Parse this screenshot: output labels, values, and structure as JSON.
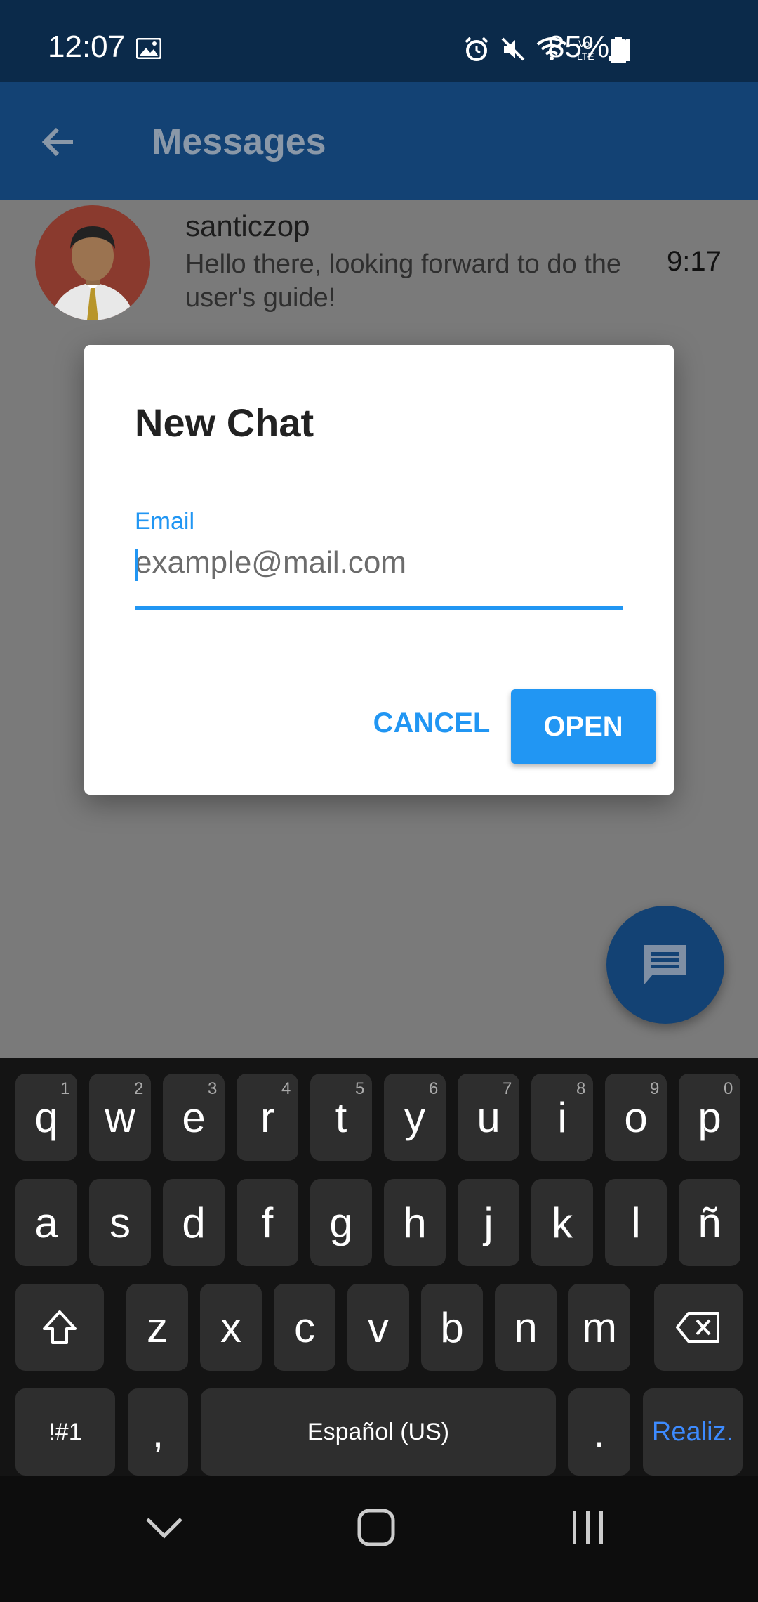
{
  "status_bar": {
    "time": "12:07",
    "battery": "85%",
    "icons": [
      "image-icon",
      "alarm-icon",
      "mute-icon",
      "wifi-icon",
      "volte-icon",
      "signal-icon",
      "battery-icon"
    ]
  },
  "app_bar": {
    "title": "Messages",
    "back_icon": "arrow-back-icon"
  },
  "chat_list": [
    {
      "name": "santiczop",
      "preview": "Hello there, looking forward to do the user's guide!",
      "time": "9:17"
    }
  ],
  "dialog": {
    "title": "New Chat",
    "field_label": "Email",
    "field_placeholder": "example@mail.com",
    "field_value": "",
    "cancel_label": "CANCEL",
    "open_label": "OPEN"
  },
  "fab": {
    "icon": "message-icon"
  },
  "keyboard": {
    "row1": [
      {
        "k": "q",
        "s": "1"
      },
      {
        "k": "w",
        "s": "2"
      },
      {
        "k": "e",
        "s": "3"
      },
      {
        "k": "r",
        "s": "4"
      },
      {
        "k": "t",
        "s": "5"
      },
      {
        "k": "y",
        "s": "6"
      },
      {
        "k": "u",
        "s": "7"
      },
      {
        "k": "i",
        "s": "8"
      },
      {
        "k": "o",
        "s": "9"
      },
      {
        "k": "p",
        "s": "0"
      }
    ],
    "row2": [
      "a",
      "s",
      "d",
      "f",
      "g",
      "h",
      "j",
      "k",
      "l",
      "ñ"
    ],
    "row3": [
      "z",
      "x",
      "c",
      "v",
      "b",
      "n",
      "m"
    ],
    "symbols_label": "!#1",
    "comma_label": ",",
    "space_label": "Español (US)",
    "period_label": ".",
    "done_label": "Realiz."
  },
  "colors": {
    "accent": "#2196f3",
    "app_bar": "#134274",
    "status_bar": "#0b2a4a"
  }
}
